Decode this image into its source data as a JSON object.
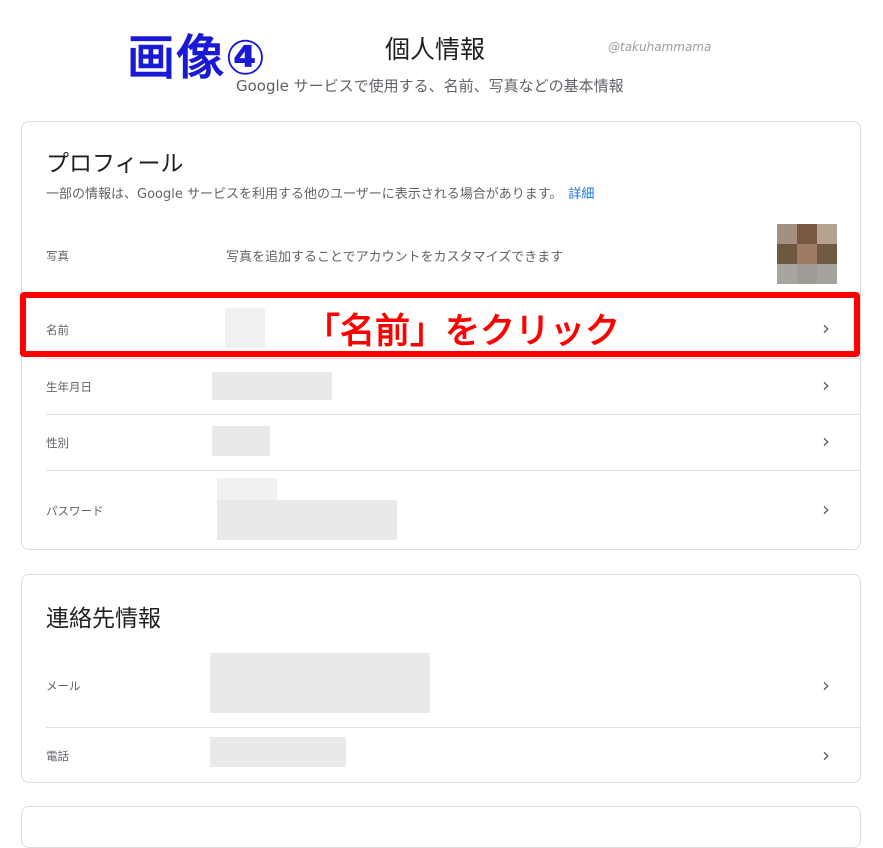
{
  "annotation": {
    "image_label": "画像④",
    "click_instruction": "「名前」をクリック"
  },
  "header": {
    "title": "個人情報",
    "subtitle": "Google サービスで使用する、名前、写真などの基本情報",
    "watermark": "@takuhammama"
  },
  "profile": {
    "title": "プロフィール",
    "description": "一部の情報は、Google サービスを利用する他のユーザーに表示される場合があります。",
    "details_link": "詳細",
    "rows": [
      {
        "label": "写真",
        "value": "写真を追加することでアカウントをカスタマイズできます"
      },
      {
        "label": "名前",
        "chevron": "›"
      },
      {
        "label": "生年月日",
        "chevron": "›"
      },
      {
        "label": "性別",
        "chevron": "›"
      },
      {
        "label": "パスワード",
        "chevron": "›"
      }
    ]
  },
  "contact": {
    "title": "連絡先情報",
    "rows": [
      {
        "label": "メール",
        "chevron": "›"
      },
      {
        "label": "電話",
        "chevron": "›"
      }
    ]
  },
  "icons": {
    "chevron": "chevron-right-icon",
    "avatar": "pixelated-avatar"
  },
  "colors": {
    "highlight": "#ff0000",
    "label_blue": "#1a1ad6",
    "link": "#1a73e8"
  }
}
